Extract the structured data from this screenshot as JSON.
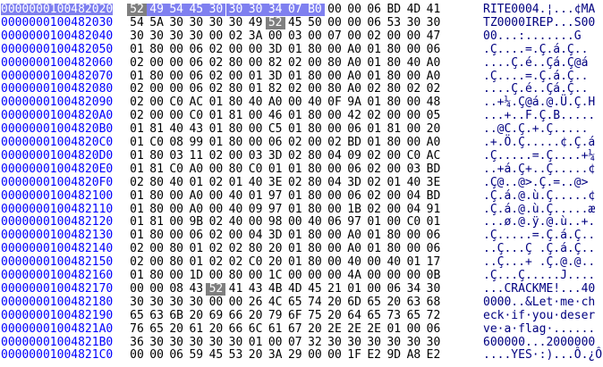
{
  "colors": {
    "address": "#0000ff",
    "ascii": "#000080",
    "selection": "#7f80f0",
    "marker": "#7f7f7f"
  },
  "rows": [
    {
      "addr": "0000000100482020",
      "bytes": [
        "52",
        "49",
        "54",
        "45",
        "30",
        "30",
        "30",
        "34",
        "07",
        "B0",
        "00",
        "00",
        "06",
        "BD",
        "4D",
        "41"
      ],
      "ascii": "RITE0004.¦...¢MA"
    },
    {
      "addr": "0000000100482030",
      "bytes": [
        "54",
        "5A",
        "30",
        "30",
        "30",
        "30",
        "49",
        "52",
        "45",
        "50",
        "00",
        "00",
        "06",
        "53",
        "30",
        "30"
      ],
      "ascii": "TZ0000IREP...S00"
    },
    {
      "addr": "0000000100482040",
      "bytes": [
        "30",
        "30",
        "30",
        "30",
        "00",
        "02",
        "3A",
        "00",
        "03",
        "00",
        "07",
        "00",
        "02",
        "00",
        "00",
        "47"
      ],
      "ascii": "00...:.......G"
    },
    {
      "addr": "0000000100482050",
      "bytes": [
        "01",
        "80",
        "00",
        "06",
        "02",
        "00",
        "00",
        "3D",
        "01",
        "80",
        "00",
        "A0",
        "01",
        "80",
        "00",
        "06"
      ],
      "ascii": ".Ç....=.Ç.á.Ç.."
    },
    {
      "addr": "0000000100482060",
      "bytes": [
        "02",
        "00",
        "00",
        "06",
        "02",
        "80",
        "00",
        "82",
        "02",
        "00",
        "80",
        "A0",
        "01",
        "80",
        "40",
        "A0"
      ],
      "ascii": "....Ç.é..Çá.Ç@á"
    },
    {
      "addr": "0000000100482070",
      "bytes": [
        "01",
        "80",
        "00",
        "06",
        "02",
        "00",
        "01",
        "3D",
        "01",
        "80",
        "00",
        "A0",
        "01",
        "80",
        "00",
        "A0"
      ],
      "ascii": ".Ç....=.Ç.á.Ç.."
    },
    {
      "addr": "0000000100482080",
      "bytes": [
        "02",
        "00",
        "00",
        "06",
        "02",
        "80",
        "01",
        "82",
        "02",
        "00",
        "80",
        "A0",
        "02",
        "80",
        "02",
        "02"
      ],
      "ascii": "....Ç.é..Çá.Ç.."
    },
    {
      "addr": "0000000100482090",
      "bytes": [
        "02",
        "00",
        "C0",
        "AC",
        "01",
        "80",
        "40",
        "A0",
        "00",
        "40",
        "0F",
        "9A",
        "01",
        "80",
        "00",
        "48"
      ],
      "ascii": "..+¼.Ç@á.@.Ü.Ç.H"
    },
    {
      "addr": "00000001004820A0",
      "bytes": [
        "02",
        "00",
        "00",
        "C0",
        "01",
        "81",
        "00",
        "46",
        "01",
        "80",
        "00",
        "42",
        "02",
        "00",
        "00",
        "05"
      ],
      "ascii": "...+..F.Ç.B....."
    },
    {
      "addr": "00000001004820B0",
      "bytes": [
        "01",
        "81",
        "40",
        "43",
        "01",
        "80",
        "00",
        "C5",
        "01",
        "80",
        "00",
        "06",
        "01",
        "81",
        "00",
        "20"
      ],
      "ascii": "..@C.Ç.+.Ç..... "
    },
    {
      "addr": "00000001004820C0",
      "bytes": [
        "01",
        "C0",
        "08",
        "99",
        "01",
        "80",
        "00",
        "06",
        "02",
        "00",
        "02",
        "BD",
        "01",
        "80",
        "00",
        "A0"
      ],
      "ascii": ".+.Ö.Ç.....¢.Ç.á"
    },
    {
      "addr": "00000001004820D0",
      "bytes": [
        "01",
        "80",
        "03",
        "11",
        "02",
        "00",
        "03",
        "3D",
        "02",
        "80",
        "04",
        "09",
        "02",
        "00",
        "C0",
        "AC"
      ],
      "ascii": ".Ç.....=.Ç....+¼"
    },
    {
      "addr": "00000001004820E0",
      "bytes": [
        "01",
        "81",
        "C0",
        "A0",
        "00",
        "80",
        "C0",
        "01",
        "01",
        "80",
        "00",
        "06",
        "02",
        "00",
        "03",
        "BD"
      ],
      "ascii": "..+á.Ç+..Ç.....¢"
    },
    {
      "addr": "00000001004820F0",
      "bytes": [
        "02",
        "80",
        "40",
        "01",
        "02",
        "01",
        "40",
        "3E",
        "02",
        "80",
        "04",
        "3D",
        "02",
        "01",
        "40",
        "3E"
      ],
      "ascii": ".Ç@..@>.Ç.=..@>"
    },
    {
      "addr": "0000000100482100",
      "bytes": [
        "01",
        "80",
        "00",
        "A0",
        "00",
        "40",
        "01",
        "97",
        "01",
        "80",
        "00",
        "06",
        "02",
        "00",
        "04",
        "BD"
      ],
      "ascii": ".Ç.á.@.ù.Ç.....¢"
    },
    {
      "addr": "0000000100482110",
      "bytes": [
        "01",
        "80",
        "00",
        "A0",
        "00",
        "40",
        "09",
        "97",
        "01",
        "80",
        "00",
        "1B",
        "02",
        "00",
        "04",
        "91"
      ],
      "ascii": ".Ç.á.@.ù.Ç.....æ"
    },
    {
      "addr": "0000000100482120",
      "bytes": [
        "01",
        "81",
        "00",
        "9B",
        "02",
        "40",
        "00",
        "98",
        "00",
        "40",
        "06",
        "97",
        "01",
        "00",
        "C0",
        "01"
      ],
      "ascii": "...ø.@.ÿ.@.ù..+."
    },
    {
      "addr": "0000000100482130",
      "bytes": [
        "01",
        "80",
        "00",
        "06",
        "02",
        "00",
        "04",
        "3D",
        "01",
        "80",
        "00",
        "A0",
        "01",
        "80",
        "00",
        "06"
      ],
      "ascii": ".Ç.....=.Ç.á.Ç.."
    },
    {
      "addr": "0000000100482140",
      "bytes": [
        "02",
        "00",
        "80",
        "01",
        "02",
        "02",
        "80",
        "20",
        "01",
        "80",
        "00",
        "A0",
        "01",
        "80",
        "00",
        "06"
      ],
      "ascii": "..Ç...Ç .Ç.á.Ç.."
    },
    {
      "addr": "0000000100482150",
      "bytes": [
        "02",
        "00",
        "80",
        "01",
        "02",
        "02",
        "C0",
        "20",
        "01",
        "80",
        "00",
        "40",
        "00",
        "40",
        "01",
        "17"
      ],
      "ascii": "..Ç...+ .Ç.@.@.."
    },
    {
      "addr": "0000000100482160",
      "bytes": [
        "01",
        "80",
        "00",
        "1D",
        "00",
        "80",
        "00",
        "1C",
        "00",
        "00",
        "00",
        "4A",
        "00",
        "00",
        "00",
        "0B"
      ],
      "ascii": ".Ç...Ç.....J...."
    },
    {
      "addr": "0000000100482170",
      "bytes": [
        "00",
        "00",
        "08",
        "43",
        "52",
        "41",
        "43",
        "4B",
        "4D",
        "45",
        "21",
        "01",
        "00",
        "06",
        "34",
        "30"
      ],
      "ascii": "...CRACKME!...40"
    },
    {
      "addr": "0000000100482180",
      "bytes": [
        "30",
        "30",
        "30",
        "30",
        "00",
        "00",
        "26",
        "4C",
        "65",
        "74",
        "20",
        "6D",
        "65",
        "20",
        "63",
        "68"
      ],
      "ascii": "0000..&Let·me·ch"
    },
    {
      "addr": "0000000100482190",
      "bytes": [
        "65",
        "63",
        "6B",
        "20",
        "69",
        "66",
        "20",
        "79",
        "6F",
        "75",
        "20",
        "64",
        "65",
        "73",
        "65",
        "72"
      ],
      "ascii": "eck·if·you·deser"
    },
    {
      "addr": "00000001004821A0",
      "bytes": [
        "76",
        "65",
        "20",
        "61",
        "20",
        "66",
        "6C",
        "61",
        "67",
        "20",
        "2E",
        "2E",
        "2E",
        "01",
        "00",
        "06"
      ],
      "ascii": "ve·a·flag·......"
    },
    {
      "addr": "00000001004821B0",
      "bytes": [
        "36",
        "30",
        "30",
        "30",
        "30",
        "30",
        "01",
        "00",
        "07",
        "32",
        "30",
        "30",
        "30",
        "30",
        "30",
        "30"
      ],
      "ascii": "600000...2000000"
    },
    {
      "addr": "00000001004821C0",
      "bytes": [
        "00",
        "00",
        "06",
        "59",
        "45",
        "53",
        "20",
        "3A",
        "29",
        "00",
        "00",
        "1F",
        "E2",
        "9D",
        "A8",
        "E2"
      ],
      "ascii": "....YES·:)...Ô.¿Ô"
    }
  ]
}
